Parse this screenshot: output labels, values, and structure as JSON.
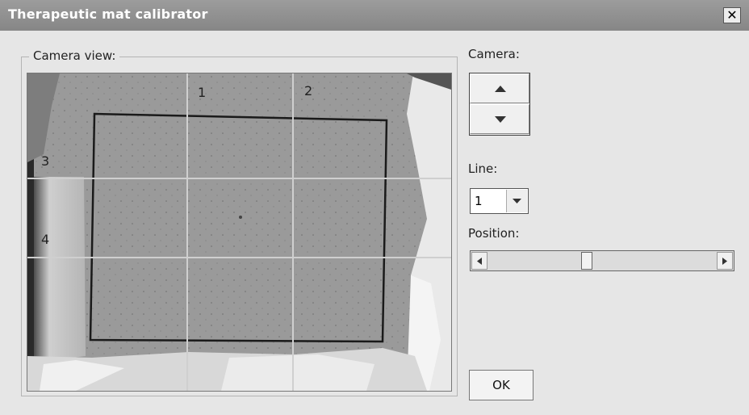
{
  "window": {
    "title": "Therapeutic mat calibrator",
    "close_glyph": "✕"
  },
  "camera_view": {
    "label": "Camera view:",
    "grid_numbers": [
      "1",
      "2",
      "3",
      "4"
    ]
  },
  "camera": {
    "label": "Camera:",
    "up_icon": "arrow-up-icon",
    "down_icon": "arrow-down-icon"
  },
  "line": {
    "label": "Line:",
    "value": "1"
  },
  "position": {
    "label": "Position:",
    "value_fraction": 0.43
  },
  "ok_button": {
    "label": "OK"
  }
}
